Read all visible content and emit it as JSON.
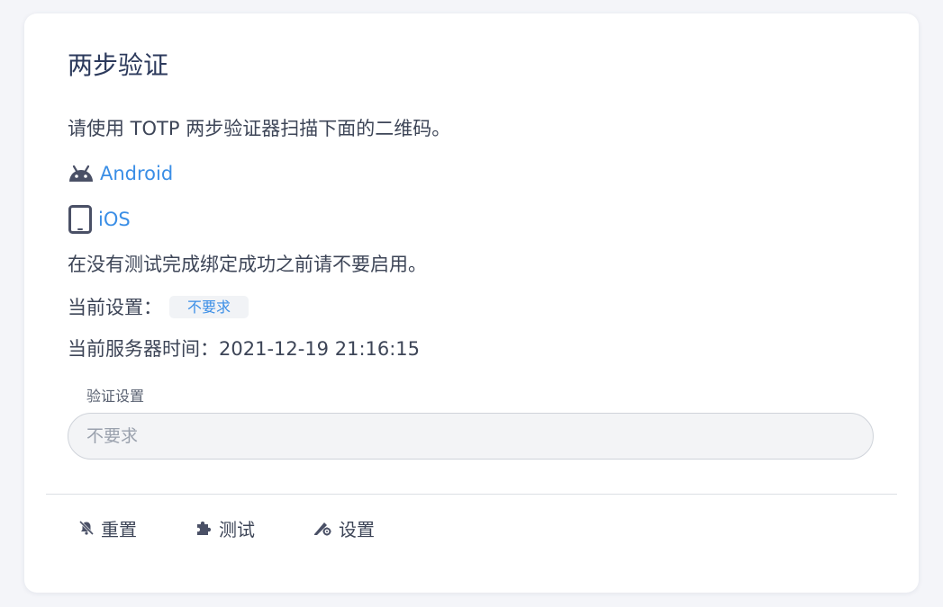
{
  "title": "两步验证",
  "intro": "请使用 TOTP 两步验证器扫描下面的二维码。",
  "links": {
    "android": {
      "label": "Android",
      "icon": "android-icon"
    },
    "ios": {
      "label": "iOS",
      "icon": "tablet-icon"
    }
  },
  "warning": "在没有测试完成绑定成功之前请不要启用。",
  "current_setting": {
    "label": "当前设置：",
    "value": "不要求"
  },
  "server_time": {
    "label": "当前服务器时间：",
    "value": "2021-12-19 21:16:15"
  },
  "verify_setting": {
    "label": "验证设置",
    "value": "不要求"
  },
  "actions": {
    "reset": {
      "label": "重置",
      "icon": "bell-off-icon"
    },
    "test": {
      "label": "测试",
      "icon": "puzzle-icon"
    },
    "settings": {
      "label": "设置",
      "icon": "pen-gear-icon"
    }
  },
  "colors": {
    "link": "#3a8ee6",
    "text": "#3d4557",
    "title": "#2c3a5c",
    "icon": "#4a5066"
  }
}
